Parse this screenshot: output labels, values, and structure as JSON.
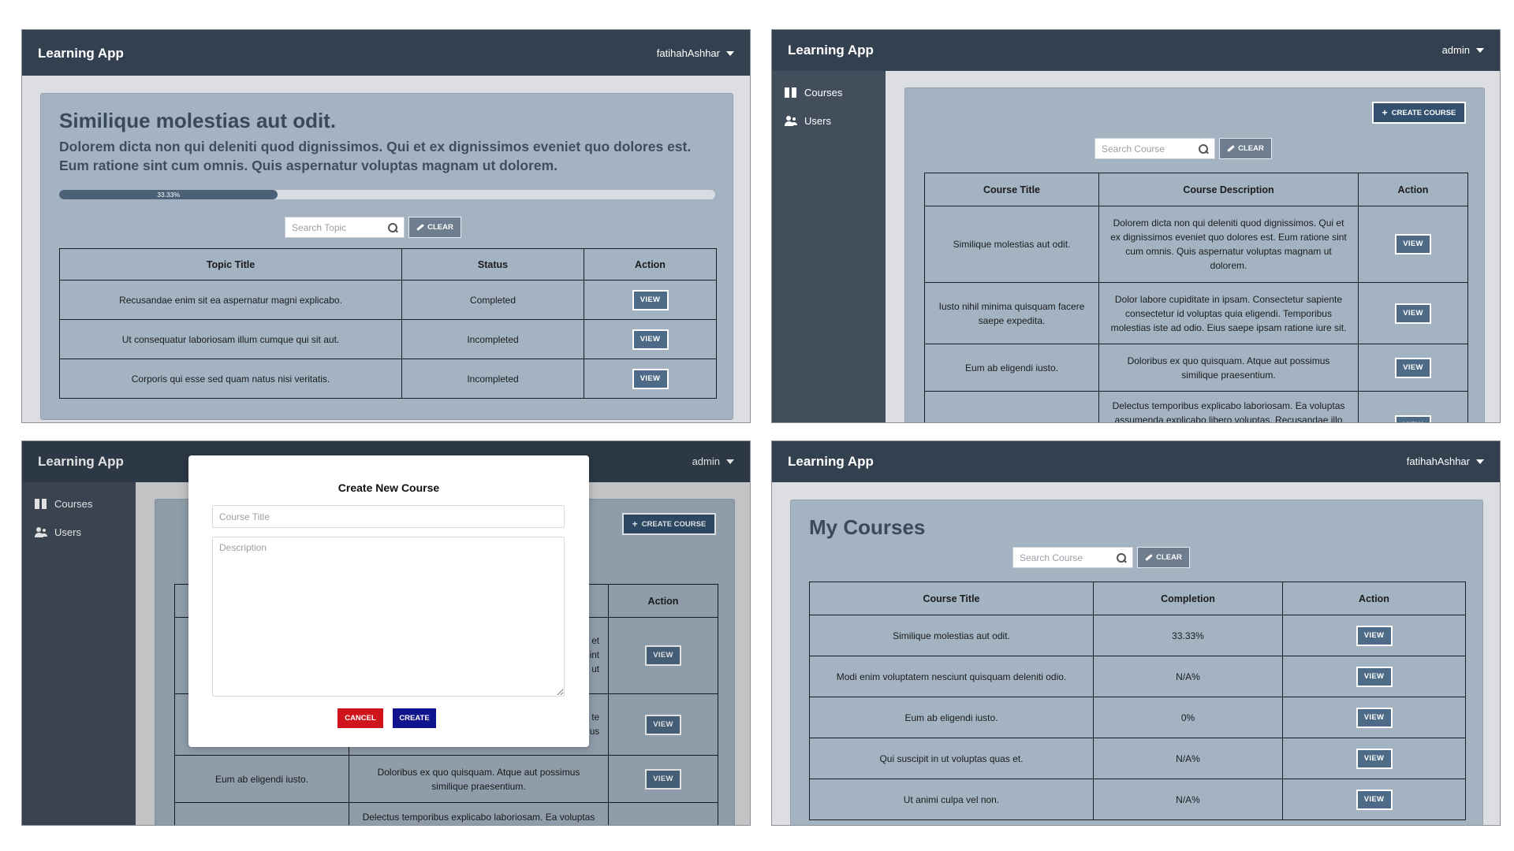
{
  "brand": "Learning App",
  "panel_topic": {
    "user": "fatihahAshhar",
    "course_title": "Similique molestias aut odit.",
    "course_description": "Dolorem dicta non qui deleniti quod dignissimos. Qui et ex dignissimos eveniet quo dolores est. Eum ratione sint cum omnis. Quis aspernatur voluptas magnam ut dolorem.",
    "progress": {
      "value": 0.3333,
      "label": "33.33%"
    },
    "search_placeholder": "Search Topic",
    "clear_label": "CLEAR",
    "headers": [
      "Topic Title",
      "Status",
      "Action"
    ],
    "rows": [
      {
        "title": "Recusandae enim sit ea aspernatur magni explicabo.",
        "status": "Completed",
        "action": "VIEW"
      },
      {
        "title": "Ut consequatur laboriosam illum cumque qui sit aut.",
        "status": "Incompleted",
        "action": "VIEW"
      },
      {
        "title": "Corporis qui esse sed quam natus nisi veritatis.",
        "status": "Incompleted",
        "action": "VIEW"
      }
    ]
  },
  "panel_admin": {
    "user": "admin",
    "sidebar": [
      "Courses",
      "Users"
    ],
    "create_label": "CREATE COURSE",
    "search_placeholder": "Search Course",
    "clear_label": "CLEAR",
    "headers": [
      "Course Title",
      "Course Description",
      "Action"
    ],
    "rows": [
      {
        "title": "Similique molestias aut odit.",
        "description": "Dolorem dicta non qui deleniti quod dignissimos. Qui et ex dignissimos eveniet quo dolores est. Eum ratione sint cum omnis. Quis aspernatur voluptas magnam ut dolorem.",
        "action": "VIEW"
      },
      {
        "title": "Iusto nihil minima quisquam facere saepe expedita.",
        "description": "Dolor labore cupiditate in ipsam. Consectetur sapiente consectetur id voluptas quia eligendi. Temporibus molestias iste ad odio. Eius saepe ipsam ratione iure sit.",
        "action": "VIEW"
      },
      {
        "title": "Eum ab eligendi iusto.",
        "description": "Doloribus ex quo quisquam. Atque aut possimus similique praesentium.",
        "action": "VIEW"
      },
      {
        "title": "",
        "description": "Delectus temporibus explicabo laboriosam. Ea voluptas assumenda explicabo libero voluptas. Recusandae illo",
        "action": "VIEW"
      }
    ]
  },
  "panel_modal": {
    "user": "admin",
    "sidebar": [
      "Courses",
      "Users"
    ],
    "create_label": "CREATE COURSE",
    "action_header": "Action",
    "action_label": "VIEW",
    "row_fragments": [
      "et",
      "int",
      "ut",
      "te",
      "us"
    ],
    "row3_title": "Eum ab eligendi iusto.",
    "row3_desc": "Doloribus ex quo quisquam. Atque aut possimus similique praesentium.",
    "row4_desc": "Delectus temporibus explicabo laboriosam. Ea voluptas",
    "modal": {
      "title": "Create New Course",
      "title_placeholder": "Course Title",
      "description_placeholder": "Description",
      "cancel_label": "CANCEL",
      "create_label": "CREATE"
    }
  },
  "panel_my_courses": {
    "user": "fatihahAshhar",
    "heading": "My Courses",
    "search_placeholder": "Search Course",
    "clear_label": "CLEAR",
    "headers": [
      "Course Title",
      "Completion",
      "Action"
    ],
    "rows": [
      {
        "title": "Similique molestias aut odit.",
        "completion": "33.33%",
        "action": "VIEW"
      },
      {
        "title": "Modi enim voluptatem nesciunt quisquam deleniti odio.",
        "completion": "N/A%",
        "action": "VIEW"
      },
      {
        "title": "Eum ab eligendi iusto.",
        "completion": "0%",
        "action": "VIEW"
      },
      {
        "title": "Qui suscipit in ut voluptas quas et.",
        "completion": "N/A%",
        "action": "VIEW"
      },
      {
        "title": "Ut animi culpa vel non.",
        "completion": "N/A%",
        "action": "VIEW"
      }
    ]
  },
  "colors": {
    "navbar": "#33404f",
    "sidebar": "#434e5c",
    "card": "#a3b3c2",
    "progress_fill": "#4a6178",
    "view_button": "#4d6a86",
    "create_button": "#33516f",
    "cancel_button": "#d0141b",
    "modal_create_button": "#11148f"
  }
}
